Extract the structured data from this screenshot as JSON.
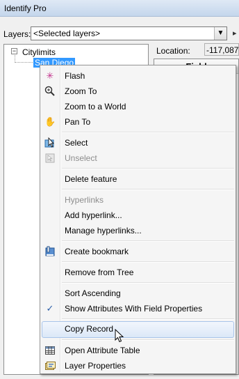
{
  "window": {
    "title": "Identify Pro"
  },
  "layers": {
    "label": "Layers:",
    "selected": "<Selected layers>"
  },
  "tree": {
    "root": "Citylimits",
    "child": "San Diego",
    "expander": "−"
  },
  "location": {
    "label": "Location:",
    "value": "-117,087"
  },
  "grid": {
    "header": "Field"
  },
  "menu": {
    "items": [
      {
        "label": "Flash",
        "icon": "flash-icon"
      },
      {
        "label": "Zoom To",
        "icon": "zoom-icon"
      },
      {
        "label": "Zoom to a World",
        "icon": ""
      },
      {
        "label": "Pan To",
        "icon": "hand-icon"
      },
      {
        "label": "Select",
        "icon": "select-icon"
      },
      {
        "label": "Unselect",
        "icon": "unselect-icon"
      },
      {
        "label": "Delete feature",
        "icon": ""
      },
      {
        "label": "Hyperlinks",
        "icon": ""
      },
      {
        "label": "Add hyperlink...",
        "icon": ""
      },
      {
        "label": "Manage hyperlinks...",
        "icon": ""
      },
      {
        "label": "Create bookmark",
        "icon": "bookmark-icon"
      },
      {
        "label": "Remove from Tree",
        "icon": ""
      },
      {
        "label": "Sort Ascending",
        "icon": ""
      },
      {
        "label": "Show Attributes With Field Properties",
        "icon": "checkmark-icon"
      },
      {
        "label": "Copy Record",
        "icon": ""
      },
      {
        "label": "Open Attribute Table",
        "icon": "table-icon"
      },
      {
        "label": "Layer Properties",
        "icon": "layer-properties-icon"
      }
    ]
  }
}
